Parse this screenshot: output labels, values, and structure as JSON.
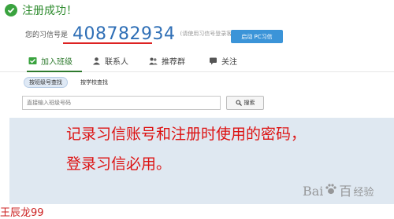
{
  "success": {
    "title": "注册成功！"
  },
  "account": {
    "label": "您的习信号是",
    "number": "408782934",
    "hint": "(请使用习信号登录客户端)",
    "launch_button": "启动 PC习信"
  },
  "tabs": [
    {
      "label": "加入班级",
      "icon": "join-class-icon"
    },
    {
      "label": "联系人",
      "icon": "contacts-icon"
    },
    {
      "label": "推荐群",
      "icon": "recommended-group-icon"
    },
    {
      "label": "关注",
      "icon": "follow-icon"
    }
  ],
  "subtabs": [
    {
      "label": "按班级号查找"
    },
    {
      "label": "按学校查找"
    }
  ],
  "search": {
    "placeholder": "直接输入班级号码",
    "button": "搜索"
  },
  "note": {
    "line1": "记录习信账号和注册时使用的密码，",
    "line2": "登录习信必用。"
  },
  "author": "王辰龙99",
  "watermark": {
    "brand_left": "Bai",
    "brand_right": "百",
    "suffix": "经验"
  },
  "colors": {
    "accent_blue": "#3b94d8",
    "success_green": "#3aa33f",
    "note_red": "#dd1111"
  }
}
